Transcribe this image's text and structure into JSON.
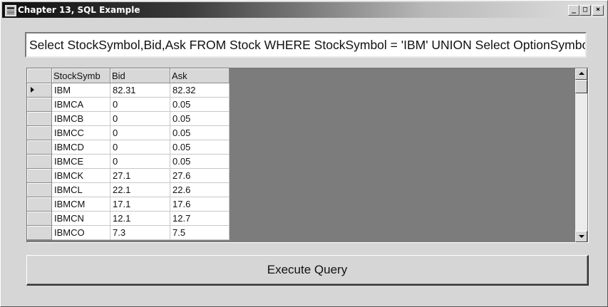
{
  "window": {
    "title": "Chapter 13, SQL Example",
    "controls": {
      "minimize": "_",
      "maximize": "□",
      "close": "×"
    }
  },
  "query": {
    "text": "Select StockSymbol,Bid,Ask FROM Stock WHERE StockSymbol = 'IBM' UNION Select OptionSymbo"
  },
  "grid": {
    "columns": [
      "StockSymb",
      "Bid",
      "Ask"
    ],
    "current_row_indicator": "▶",
    "rows": [
      {
        "symbol": "IBM",
        "bid": "82.31",
        "ask": "82.32"
      },
      {
        "symbol": "IBMCA",
        "bid": "0",
        "ask": "0.05"
      },
      {
        "symbol": "IBMCB",
        "bid": "0",
        "ask": "0.05"
      },
      {
        "symbol": "IBMCC",
        "bid": "0",
        "ask": "0.05"
      },
      {
        "symbol": "IBMCD",
        "bid": "0",
        "ask": "0.05"
      },
      {
        "symbol": "IBMCE",
        "bid": "0",
        "ask": "0.05"
      },
      {
        "symbol": "IBMCK",
        "bid": "27.1",
        "ask": "27.6"
      },
      {
        "symbol": "IBMCL",
        "bid": "22.1",
        "ask": "22.6"
      },
      {
        "symbol": "IBMCM",
        "bid": "17.1",
        "ask": "17.6"
      },
      {
        "symbol": "IBMCN",
        "bid": "12.1",
        "ask": "12.7"
      },
      {
        "symbol": "IBMCO",
        "bid": "7.3",
        "ask": "7.5"
      }
    ]
  },
  "actions": {
    "execute_label": "Execute Query"
  },
  "colors": {
    "grid_background": "#7c7c7c",
    "window_background": "#d6d6d6"
  }
}
